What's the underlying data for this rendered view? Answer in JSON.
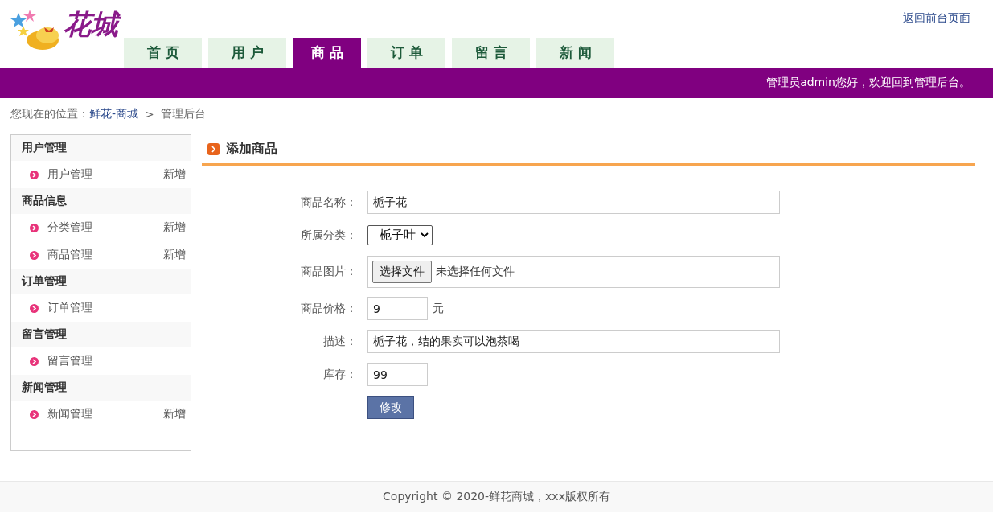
{
  "header": {
    "logo_text": "花城",
    "return_link": "返回前台页面"
  },
  "tabs": [
    {
      "label": "首页",
      "selected": false
    },
    {
      "label": "用户",
      "selected": false
    },
    {
      "label": "商品",
      "selected": true
    },
    {
      "label": "订单",
      "selected": false
    },
    {
      "label": "留言",
      "selected": false
    },
    {
      "label": "新闻",
      "selected": false
    }
  ],
  "welcome": "管理员admin您好，欢迎回到管理后台。",
  "breadcrumb": {
    "prefix": "您现在的位置：",
    "link": "鲜花-商城",
    "separator": ">",
    "current": "管理后台"
  },
  "sidebar": [
    {
      "title": "用户管理",
      "items": [
        {
          "label": "用户管理",
          "action": "新增"
        }
      ]
    },
    {
      "title": "商品信息",
      "items": [
        {
          "label": "分类管理",
          "action": "新增"
        },
        {
          "label": "商品管理",
          "action": "新增"
        }
      ]
    },
    {
      "title": "订单管理",
      "items": [
        {
          "label": "订单管理"
        }
      ]
    },
    {
      "title": "留言管理",
      "items": [
        {
          "label": "留言管理"
        }
      ]
    },
    {
      "title": "新闻管理",
      "items": [
        {
          "label": "新闻管理",
          "action": "新增"
        }
      ]
    }
  ],
  "panel_title": "添加商品",
  "form": [
    {
      "kind": "text",
      "label": "商品名称：",
      "value": "栀子花"
    },
    {
      "kind": "select",
      "label": "所属分类：",
      "value": "栀子叶"
    },
    {
      "kind": "file",
      "label": "商品图片：",
      "button": "选择文件",
      "status": "未选择任何文件"
    },
    {
      "kind": "number",
      "label": "商品价格：",
      "value": "9",
      "unit": "元"
    },
    {
      "kind": "text",
      "label": "描述：",
      "value": "栀子花，结的果实可以泡茶喝"
    },
    {
      "kind": "number",
      "label": "库存：",
      "value": "99"
    }
  ],
  "submit": "修改",
  "footer": "Copyright © 2020-鲜花商城，xxx版权所有"
}
